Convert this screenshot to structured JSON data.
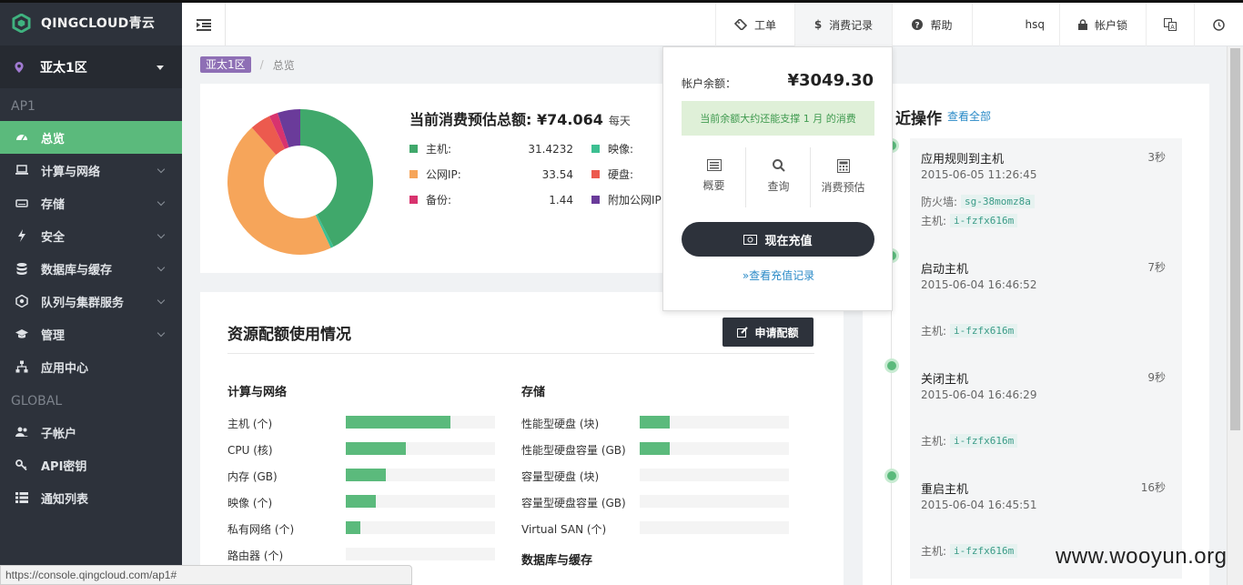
{
  "app": {
    "brand": "QINGCLOUD青云",
    "zone": "亚太1区"
  },
  "colors": {
    "sidebar_bg": "#2d323b",
    "accent_green": "#5bba7c",
    "zone_badge": "#8e6fb5",
    "link_blue": "#2a8ac7"
  },
  "sidebar": {
    "sections": [
      {
        "label": "AP1",
        "items": [
          {
            "label": "总览",
            "icon": "dashboard-icon",
            "active": true,
            "expandable": false
          },
          {
            "label": "计算与网络",
            "icon": "laptop-icon",
            "active": false,
            "expandable": true
          },
          {
            "label": "存储",
            "icon": "hdd-icon",
            "active": false,
            "expandable": true
          },
          {
            "label": "安全",
            "icon": "bolt-icon",
            "active": false,
            "expandable": true
          },
          {
            "label": "数据库与缓存",
            "icon": "database-icon",
            "active": false,
            "expandable": true
          },
          {
            "label": "队列与集群服务",
            "icon": "cluster-icon",
            "active": false,
            "expandable": true
          },
          {
            "label": "管理",
            "icon": "graduation-cap-icon",
            "active": false,
            "expandable": true
          },
          {
            "label": "应用中心",
            "icon": "sitemap-icon",
            "active": false,
            "expandable": false
          }
        ]
      },
      {
        "label": "GLOBAL",
        "items": [
          {
            "label": "子帐户",
            "icon": "users-icon",
            "active": false,
            "expandable": false
          },
          {
            "label": "API密钥",
            "icon": "key-icon",
            "active": false,
            "expandable": false
          },
          {
            "label": "通知列表",
            "icon": "list-icon",
            "active": false,
            "expandable": false
          }
        ]
      }
    ]
  },
  "header": {
    "ticket": "工单",
    "billing": "消费记录",
    "help": "帮助",
    "user": "hsq",
    "account_lock": "帐户锁"
  },
  "breadcrumb": {
    "zone": "亚太1区",
    "page": "总览"
  },
  "summary": {
    "title": "当前消费预估总额: ¥74.064",
    "unit": "每天"
  },
  "chart_data": {
    "type": "pie",
    "donut": true,
    "title": "当前消费预估总额: ¥74.064",
    "slices": [
      {
        "name": "主机:",
        "value": 31.4232,
        "color": "#40a86b"
      },
      {
        "name": "映像:",
        "value": 0.5,
        "color": "#3cbf91"
      },
      {
        "name": "公网IP:",
        "value": 33.54,
        "color": "#f6a55a"
      },
      {
        "name": "硬盘:",
        "value": 3.4,
        "color": "#ec5a4e"
      },
      {
        "name": "备份:",
        "value": 1.44,
        "color": "#d8336e"
      },
      {
        "name": "附加公网IP",
        "value": 3.74,
        "color": "#6a3b9a"
      }
    ],
    "legend_values": [
      "31.4232",
      "",
      "33.54",
      "",
      "1.44",
      ""
    ]
  },
  "quota": {
    "title": "资源配额使用情况",
    "apply_button": "申请配额",
    "groups": [
      {
        "title": "计算与网络",
        "rows": [
          {
            "label": "主机 (个)",
            "fraction": 0.7
          },
          {
            "label": "CPU (核)",
            "fraction": 0.4
          },
          {
            "label": "内存 (GB)",
            "fraction": 0.27
          },
          {
            "label": "映像 (个)",
            "fraction": 0.2
          },
          {
            "label": "私有网络 (个)",
            "fraction": 0.1
          },
          {
            "label": "路由器 (个)",
            "fraction": 0.0
          }
        ]
      },
      {
        "title": "存储",
        "rows": [
          {
            "label": "性能型硬盘 (块)",
            "fraction": 0.2
          },
          {
            "label": "性能型硬盘容量 (GB)",
            "fraction": 0.2
          },
          {
            "label": "容量型硬盘 (块)",
            "fraction": 0.0
          },
          {
            "label": "容量型硬盘容量 (GB)",
            "fraction": 0.0
          },
          {
            "label": "Virtual SAN (个)",
            "fraction": 0.0
          }
        ]
      }
    ],
    "group3_title": "数据库与缓存"
  },
  "activity": {
    "title": "近操作",
    "view_all": "查看全部",
    "items": [
      {
        "title": "应用规则到主机",
        "ago": "3秒",
        "datetime": "2015-06-05 11:26:45",
        "fields": [
          {
            "k": "防火墙:",
            "v": "sg-38momz8a"
          },
          {
            "k": "主机:",
            "v": "i-fzfx616m"
          }
        ]
      },
      {
        "title": "启动主机",
        "ago": "7秒",
        "datetime": "2015-06-04 16:46:52",
        "fields": [
          {
            "k": "主机:",
            "v": "i-fzfx616m"
          }
        ]
      },
      {
        "title": "关闭主机",
        "ago": "9秒",
        "datetime": "2015-06-04 16:46:29",
        "fields": [
          {
            "k": "主机:",
            "v": "i-fzfx616m"
          }
        ]
      },
      {
        "title": "重启主机",
        "ago": "16秒",
        "datetime": "2015-06-04 16:45:51",
        "fields": [
          {
            "k": "主机:",
            "v": "i-fzfx616m"
          }
        ]
      }
    ]
  },
  "billing_popup": {
    "balance_label": "帐户余额：",
    "balance_value": "¥3049.30",
    "hint": "当前余额大约还能支撑 1 月 的消费",
    "actions": [
      {
        "label": "概要",
        "icon": "list-alt-icon"
      },
      {
        "label": "查询",
        "icon": "search-icon"
      },
      {
        "label": "消费预估",
        "icon": "calculator-icon"
      }
    ],
    "recharge": "现在充值",
    "view_records": "»查看充值记录"
  },
  "statusbar": {
    "url": "https://console.qingcloud.com/ap1#"
  },
  "watermark": "www.wooyun.org"
}
